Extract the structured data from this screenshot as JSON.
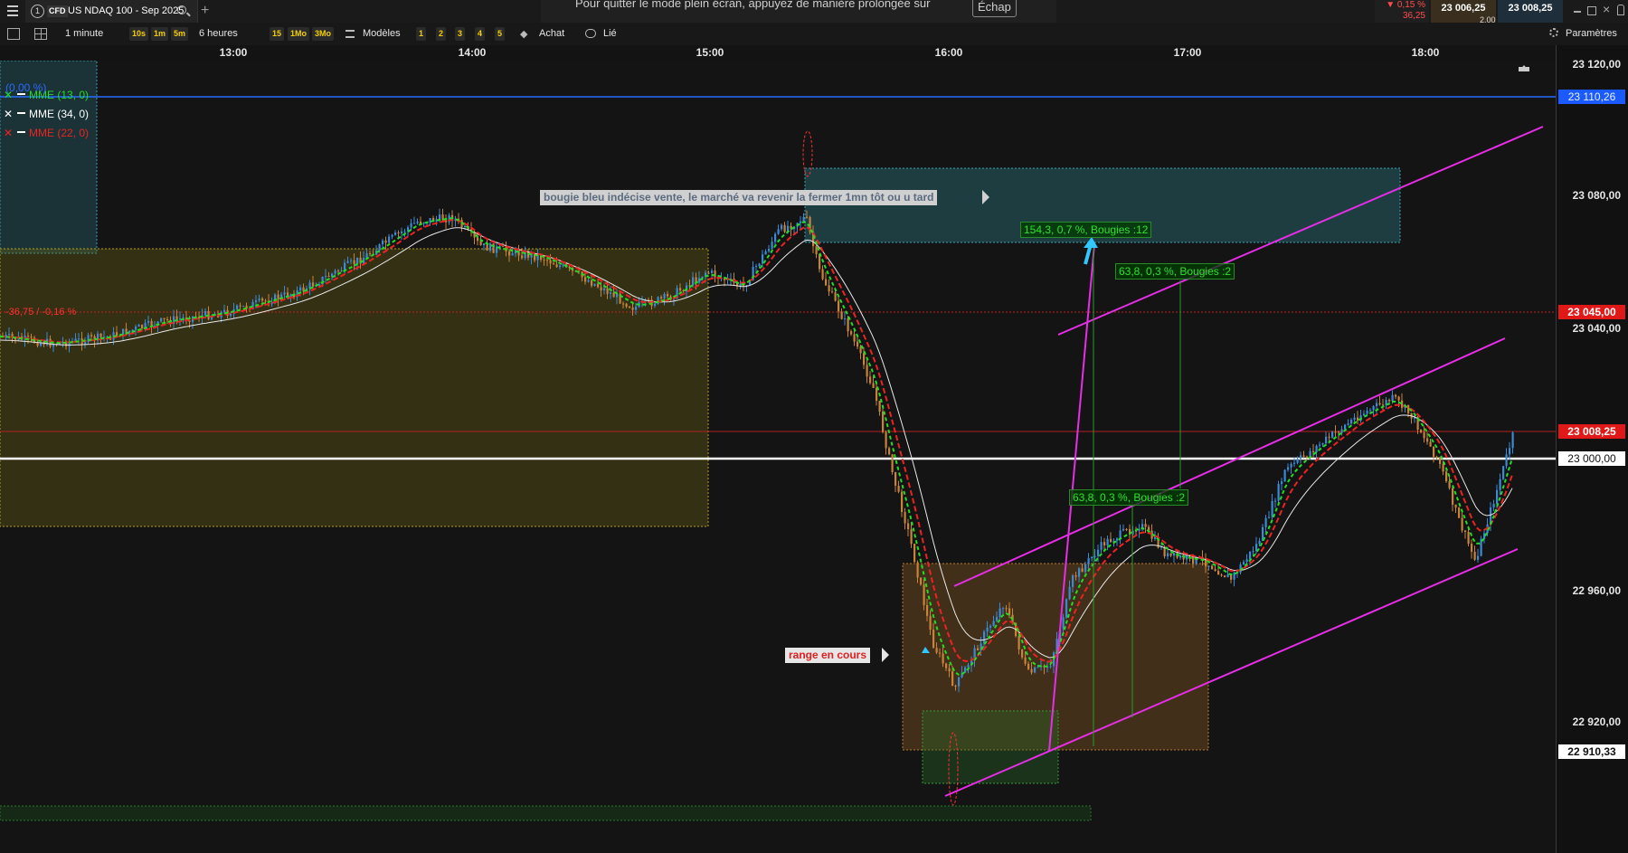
{
  "topbar": {
    "tab_number": "1",
    "cfd_badge": "CFD",
    "instrument": "US NDAQ 100 - Sep 2025",
    "fullscreen_notice": "Pour quitter le mode plein écran, appuyez de manière prolongée sur",
    "escape_key": "Échap",
    "change_pct": "▼ 0,15 %",
    "change_pts": "36,25",
    "bid": "23 006,25",
    "spread": "2,00",
    "ask": "23 008,25"
  },
  "toolbar": {
    "interval": "1 minute",
    "quick_intervals": [
      "10s",
      "1m",
      "5m"
    ],
    "range": "6 heures",
    "quick_ranges": [
      "15",
      "1Mo",
      "3Mo"
    ],
    "models": "Modèles",
    "layouts": [
      "1",
      "2",
      "3",
      "4",
      "5"
    ],
    "buy": "Achat",
    "linked": "Lié",
    "settings": "Paramètres"
  },
  "time_axis": [
    "13:00",
    "14:00",
    "15:00",
    "16:00",
    "17:00",
    "18:00"
  ],
  "price_axis": [
    "23 120,00",
    "23 080,00",
    "23 040,00",
    "22 960,00",
    "22 920,00"
  ],
  "price_badges": {
    "blue_line": "23 110,26",
    "alert_level": "23 045,00",
    "last_price": "23 008,25",
    "round_level": "23 000,00",
    "low_level": "22 910,33"
  },
  "legend": [
    {
      "name": "MME (13, 0)",
      "color": "#22dd22"
    },
    {
      "name": "MME (34, 0)",
      "color": "#ffffff"
    },
    {
      "name": "MME (22, 0)",
      "color": "#ee2222"
    }
  ],
  "chart_labels": {
    "zone_pct": "(0,00 %)",
    "change_label": "-36,75 / -0,16 %",
    "note_blue": "bougie bleu indécise vente, le marché va revenir la fermer 1mn tôt ou u tard",
    "note_range": "range en cours",
    "measure_1": "154,3, 0,7 %, Bougies :12",
    "measure_2": "63,8, 0,3 %, Bougies :2",
    "measure_3": "63,8, 0,3 %, Bougies :2"
  },
  "colors": {
    "ema_fast": "#22dd22",
    "ema_slow": "#ffffff",
    "ema_mid": "#ee2222",
    "channel": "#e62ee6",
    "bull_candle": "#3a8ad8",
    "bear_candle": "#c8823a"
  }
}
